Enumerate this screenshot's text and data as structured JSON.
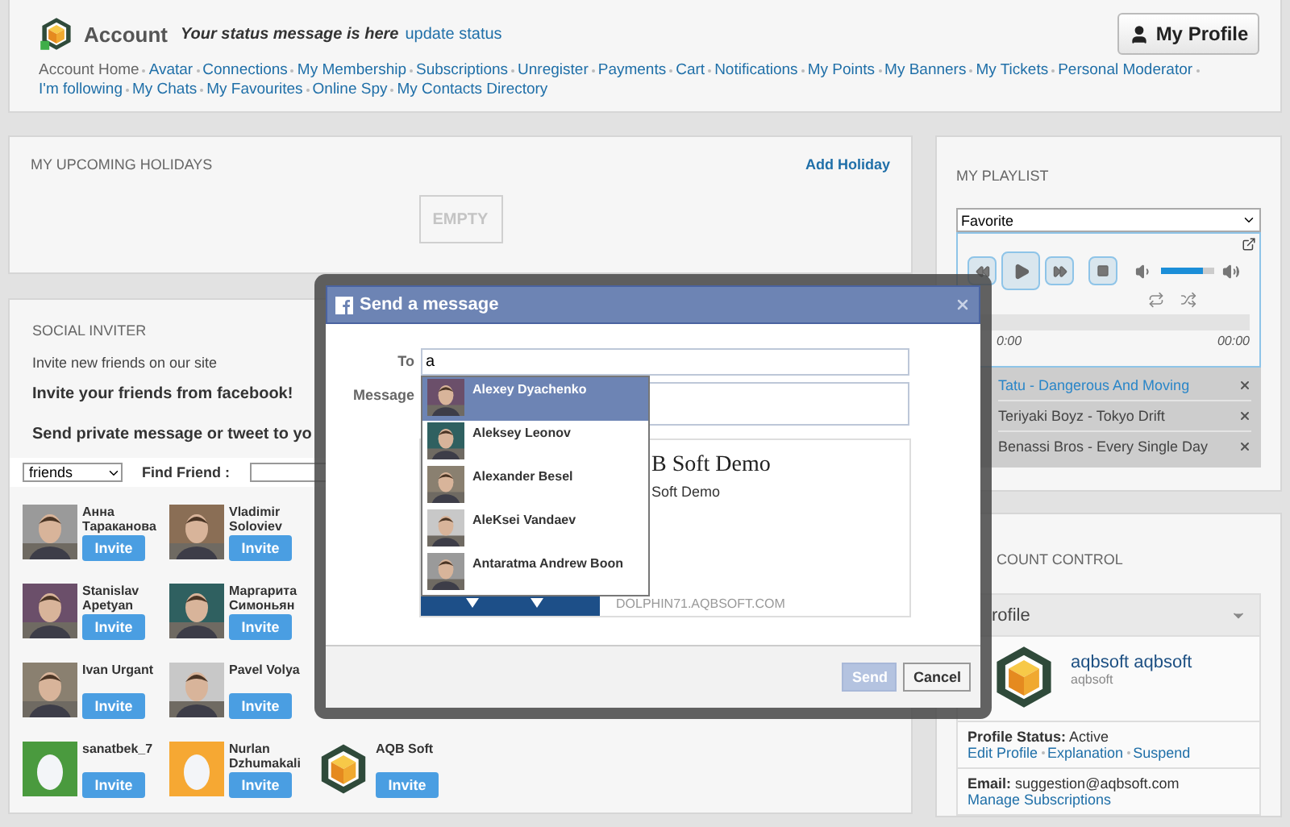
{
  "header": {
    "title": "Account",
    "status": "Your status message is here",
    "status_link": "update status",
    "profile_button": "My Profile",
    "nav": [
      {
        "label": "Account Home",
        "selected": true
      },
      {
        "label": "Avatar",
        "selected": false
      },
      {
        "label": "Connections",
        "selected": false
      },
      {
        "label": "My Membership",
        "selected": false
      },
      {
        "label": "Subscriptions",
        "selected": false
      },
      {
        "label": "Unregister",
        "selected": false
      },
      {
        "label": "Payments",
        "selected": false
      },
      {
        "label": "Cart",
        "selected": false
      },
      {
        "label": "Notifications",
        "selected": false
      },
      {
        "label": "My Points",
        "selected": false
      },
      {
        "label": "My Banners",
        "selected": false
      },
      {
        "label": "My Tickets",
        "selected": false
      },
      {
        "label": "Personal Moderator",
        "selected": false
      },
      {
        "label": "I'm following",
        "selected": false
      },
      {
        "label": "My Chats",
        "selected": false
      },
      {
        "label": "My Favourites",
        "selected": false
      },
      {
        "label": "Online Spy",
        "selected": false
      },
      {
        "label": "My Contacts Directory",
        "selected": false
      }
    ]
  },
  "holidays": {
    "title": "MY UPCOMING HOLIDAYS",
    "action": "Add Holiday",
    "empty": "EMPTY"
  },
  "inviter": {
    "title": "SOCIAL INVITER",
    "intro": "Invite new friends on our site",
    "heading": "Invite your friends from facebook!",
    "subheading": "Send private message or tweet to yo",
    "filter": "friends",
    "find_label": "Find Friend :",
    "friend_rows": [
      [
        {
          "name": "Анна Тараканова",
          "invite": "Invite"
        },
        {
          "name": "Vladimir Soloviev",
          "invite": "Invite"
        }
      ],
      [
        {
          "name": "Stanislav Apetyan",
          "invite": "Invite"
        },
        {
          "name": "Маргарита Симоньян",
          "invite": "Invite"
        }
      ],
      [
        {
          "name": "Ivan Urgant",
          "invite": "Invite"
        },
        {
          "name": "Pavel Volya",
          "invite": "Invite"
        }
      ],
      [
        {
          "name": "sanatbek_7",
          "kind": "egg",
          "color": "#4a9a3e",
          "invite": "Invite"
        },
        {
          "name": "Nurlan Dzhumakali",
          "kind": "egg",
          "color": "#f6a833",
          "invite": "Invite"
        },
        {
          "name": "AQB Soft",
          "kind": "logo",
          "invite": "Invite"
        }
      ]
    ]
  },
  "modal": {
    "title": "Send a message",
    "to_label": "To",
    "to_value": "a",
    "message_label": "Message",
    "suggestions": [
      {
        "name": "Alexey Dyachenko",
        "selected": true
      },
      {
        "name": "Aleksey Leonov",
        "selected": false
      },
      {
        "name": "Alexander Besel",
        "selected": false
      },
      {
        "name": "AleKsei Vandaev",
        "selected": false
      },
      {
        "name": "Antaratma Andrew Boon",
        "selected": false
      }
    ],
    "preview": {
      "title": "B Soft Demo",
      "subtitle": "Soft Demo",
      "url": "DOLPHIN71.AQBSOFT.COM"
    },
    "send": {
      "label": "Send",
      "disabled": true
    },
    "cancel": {
      "label": "Cancel",
      "disabled": false
    }
  },
  "playlist": {
    "title": "MY PLAYLIST",
    "list": "Favorite",
    "volume": {
      "level": 0.78
    },
    "progress": {
      "level": 0
    },
    "elapsed": "0:00",
    "total": "00:00",
    "tracks": [
      {
        "title": "Tatu - Dangerous And Moving",
        "selected": true
      },
      {
        "title": "Teriyaki Boyz - Tokyo Drift",
        "selected": false
      },
      {
        "title": "Benassi Bros - Every Single Day",
        "selected": false
      }
    ]
  },
  "account": {
    "title": "COUNT CONTROL",
    "section": "rofile",
    "name": "aqbsoft aqbsoft",
    "username": "aqbsoft",
    "status_label": "Profile Status:",
    "status": "Active",
    "links": [
      "Edit Profile",
      "Explanation",
      "Suspend"
    ],
    "email_label": "Email:",
    "email": "suggestion@aqbsoft.com",
    "manage": "Manage Subscriptions"
  }
}
